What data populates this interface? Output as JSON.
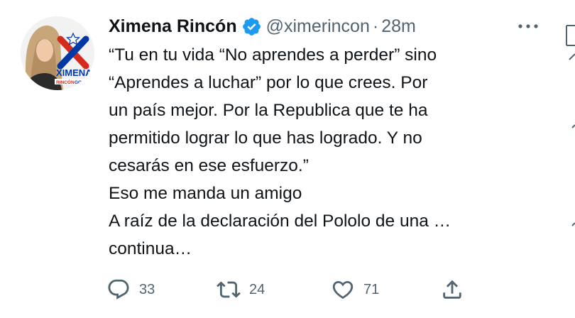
{
  "author": {
    "display_name": "Ximena Rincón",
    "handle": "@ximerincon",
    "separator": "·",
    "time": "28m",
    "verified": true,
    "avatar_text": {
      "name": "XIMENA",
      "surname_a": "RINCÓN",
      "surname_b": "GONZÁ"
    }
  },
  "tweet": {
    "lines": [
      "“Tu en tu vida “No aprendes a perder” sino",
      "“Aprendes a luchar” por lo que crees. Por",
      "un país mejor. Por la Republica que te ha",
      "permitido lograr lo que has logrado. Y no",
      "cesarás en ese esfuerzo.”",
      "Eso me manda un amigo",
      "A raíz de la declaración del Pololo de una …",
      "continua…"
    ]
  },
  "actions": {
    "reply_count": "33",
    "retweet_count": "24",
    "like_count": "71"
  },
  "colors": {
    "text": "#0f1419",
    "secondary": "#536471",
    "verified": "#1d9bf0",
    "flag_red": "#d52b1e",
    "flag_blue": "#0039a6"
  },
  "icons": {
    "verified": "verified-badge-icon",
    "more": "more-dots-icon",
    "reply": "reply-icon",
    "retweet": "retweet-icon",
    "like": "heart-icon",
    "share": "share-icon"
  }
}
